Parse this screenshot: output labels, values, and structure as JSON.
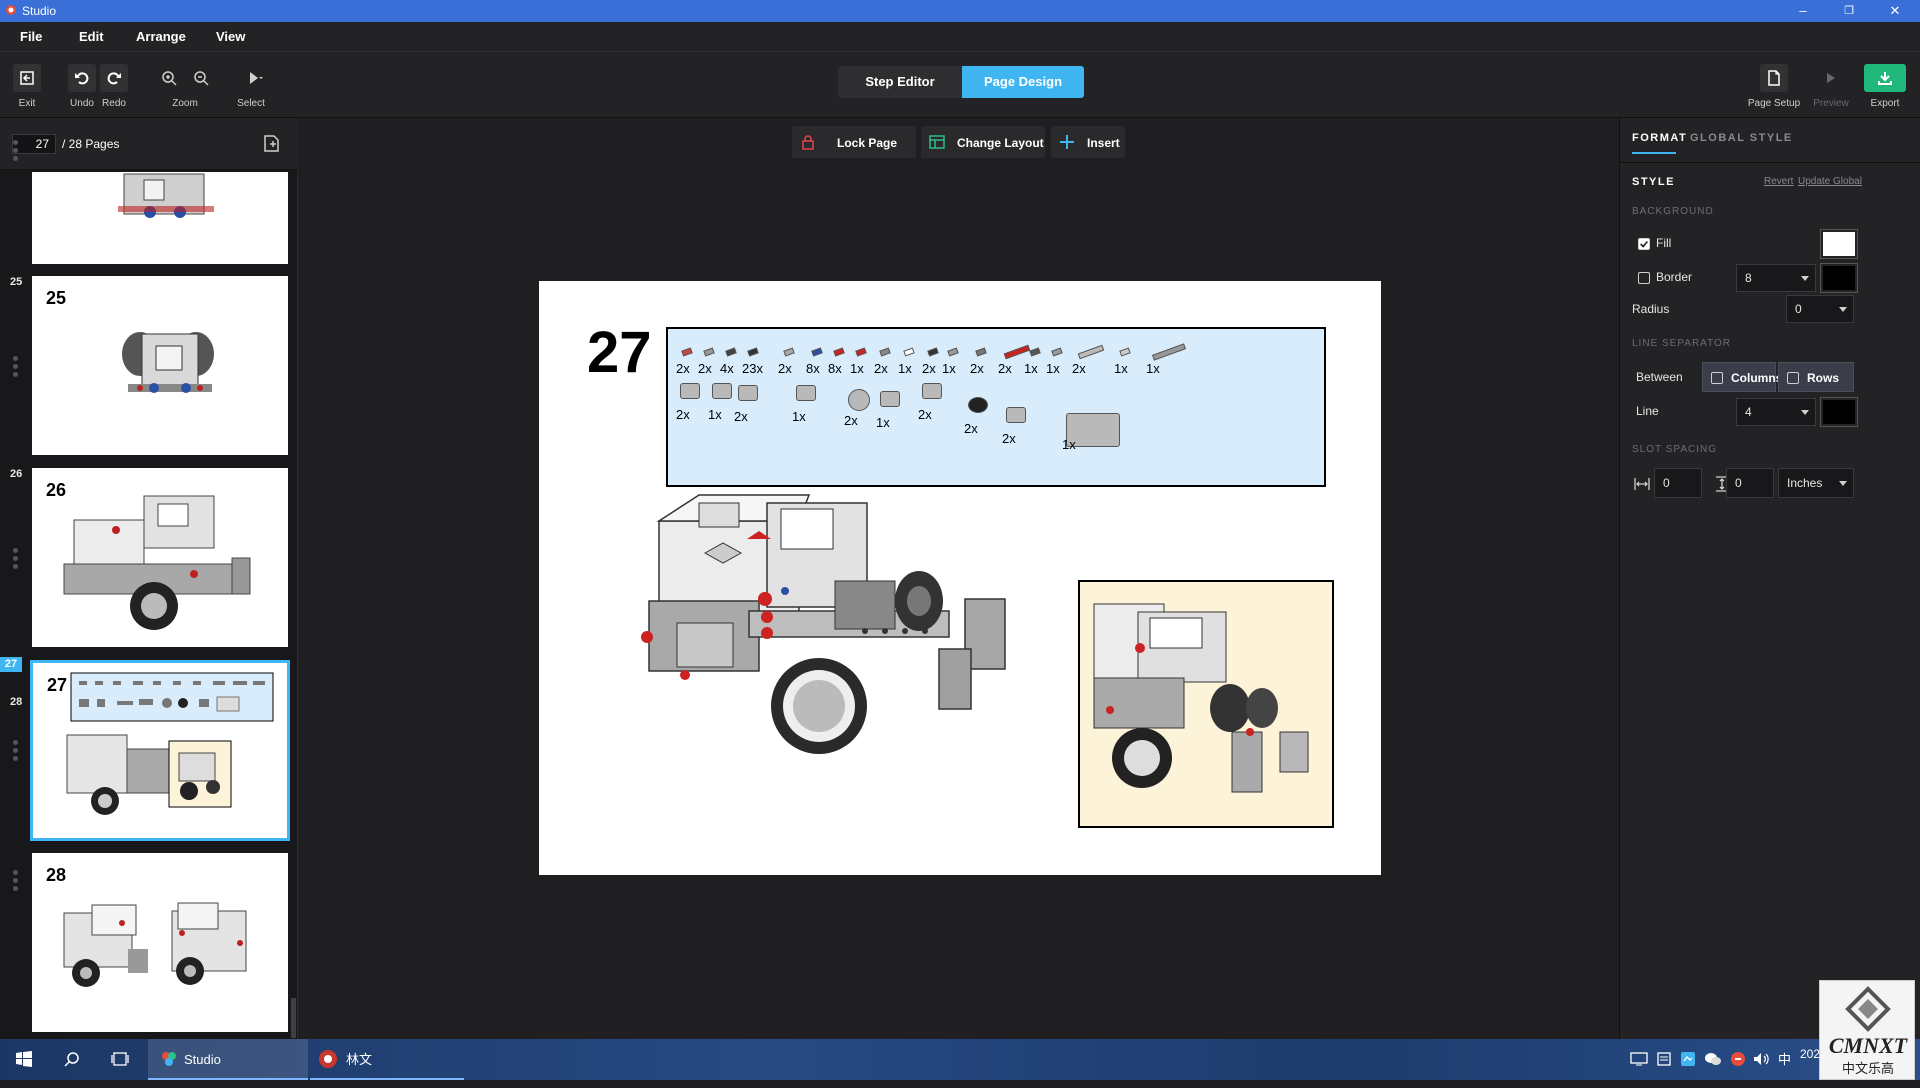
{
  "window": {
    "title": "Studio",
    "min": "–",
    "restore": "❐",
    "close": "✕"
  },
  "menu": [
    "File",
    "Edit",
    "Arrange",
    "View"
  ],
  "toolbar": {
    "exit": "Exit",
    "undo": "Undo",
    "redo": "Redo",
    "zoom": "Zoom",
    "select": "Select",
    "step_editor": "Step Editor",
    "page_design": "Page Design",
    "page_setup": "Page Setup",
    "preview": "Preview",
    "export": "Export"
  },
  "pages": {
    "current": "27",
    "total_label": "/ 28 Pages",
    "thumbs": [
      {
        "label": "25",
        "num": "25"
      },
      {
        "label": "26",
        "num": "26"
      },
      {
        "label": "27",
        "num": "27",
        "selected": true
      },
      {
        "label": "28",
        "num": "28"
      }
    ]
  },
  "canvas_tools": {
    "lock": "Lock Page",
    "layout": "Change Layout",
    "insert": "Insert"
  },
  "page": {
    "step_number": "27",
    "parts_row1": [
      "2x",
      "2x",
      "4x",
      "23x",
      "2x",
      "8x",
      "8x",
      "1x",
      "2x",
      "1x",
      "2x",
      "1x",
      "2x",
      "2x",
      "1x",
      "1x",
      "2x",
      "1x",
      "1x"
    ],
    "parts_row2": [
      "2x",
      "1x",
      "2x",
      "1x",
      "2x",
      "1x",
      "2x",
      "2x",
      "2x",
      "1x"
    ]
  },
  "format": {
    "tab_format": "FORMAT",
    "tab_global": "GLOBAL STYLE",
    "style": "STYLE",
    "revert": "Revert",
    "update_global": "Update Global",
    "background": "BACKGROUND",
    "fill": "Fill",
    "border": "Border",
    "border_value": "8",
    "radius": "Radius",
    "radius_value": "0",
    "line_separator": "LINE SEPARATOR",
    "between": "Between",
    "columns": "Columns",
    "rows": "Rows",
    "line": "Line",
    "line_value": "4",
    "slot_spacing": "SLOT SPACING",
    "h_spacing": "0",
    "v_spacing": "0",
    "units": "Inches"
  },
  "taskbar": {
    "app": "Studio",
    "app2": "林文",
    "ime": "中",
    "clock": "202"
  },
  "watermark": {
    "text1": "CMNXT",
    "text2": "中文乐高"
  },
  "colors": {
    "accent": "#3fb5f2",
    "titlebar": "#3a6fd8",
    "export": "#1fb77a",
    "parts_bg": "#d8ecfb",
    "subassembly_bg": "#fdf3d8"
  }
}
